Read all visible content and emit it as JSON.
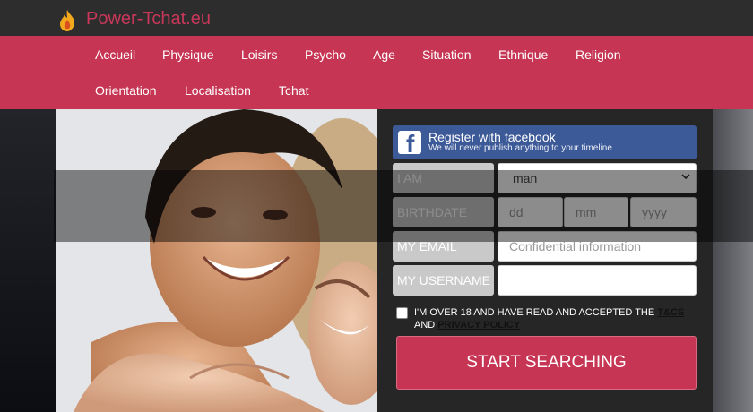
{
  "brand": {
    "name": "Power-Tchat.eu"
  },
  "nav": {
    "items": [
      {
        "label": "Accueil"
      },
      {
        "label": "Physique"
      },
      {
        "label": "Loisirs"
      },
      {
        "label": "Psycho"
      },
      {
        "label": "Age"
      },
      {
        "label": "Situation"
      },
      {
        "label": "Ethnique"
      },
      {
        "label": "Religion"
      },
      {
        "label": "Orientation"
      },
      {
        "label": "Localisation"
      },
      {
        "label": "Tchat"
      }
    ]
  },
  "facebook": {
    "title": "Register with facebook",
    "subtitle": "We will never publish anything to your timeline",
    "icon": "facebook-icon"
  },
  "form": {
    "iam_label": "I AM",
    "iam_value": "man",
    "birthdate_label": "BIRTHDATE",
    "day_placeholder": "dd",
    "month_placeholder": "mm",
    "year_placeholder": "yyyy",
    "email_label": "MY EMAIL",
    "email_placeholder": "Confidential information",
    "username_label": "MY USERNAME",
    "username_value": "",
    "terms_prefix": "I'M OVER 18 AND HAVE READ AND ACCEPTED THE",
    "terms_link": "T&CS",
    "terms_and": "AND",
    "privacy_link": "PRIVACY POLICY",
    "submit_label": "START SEARCHING"
  },
  "colors": {
    "accent": "#c63654",
    "facebook": "#3d5a98",
    "panel": "#262626"
  }
}
